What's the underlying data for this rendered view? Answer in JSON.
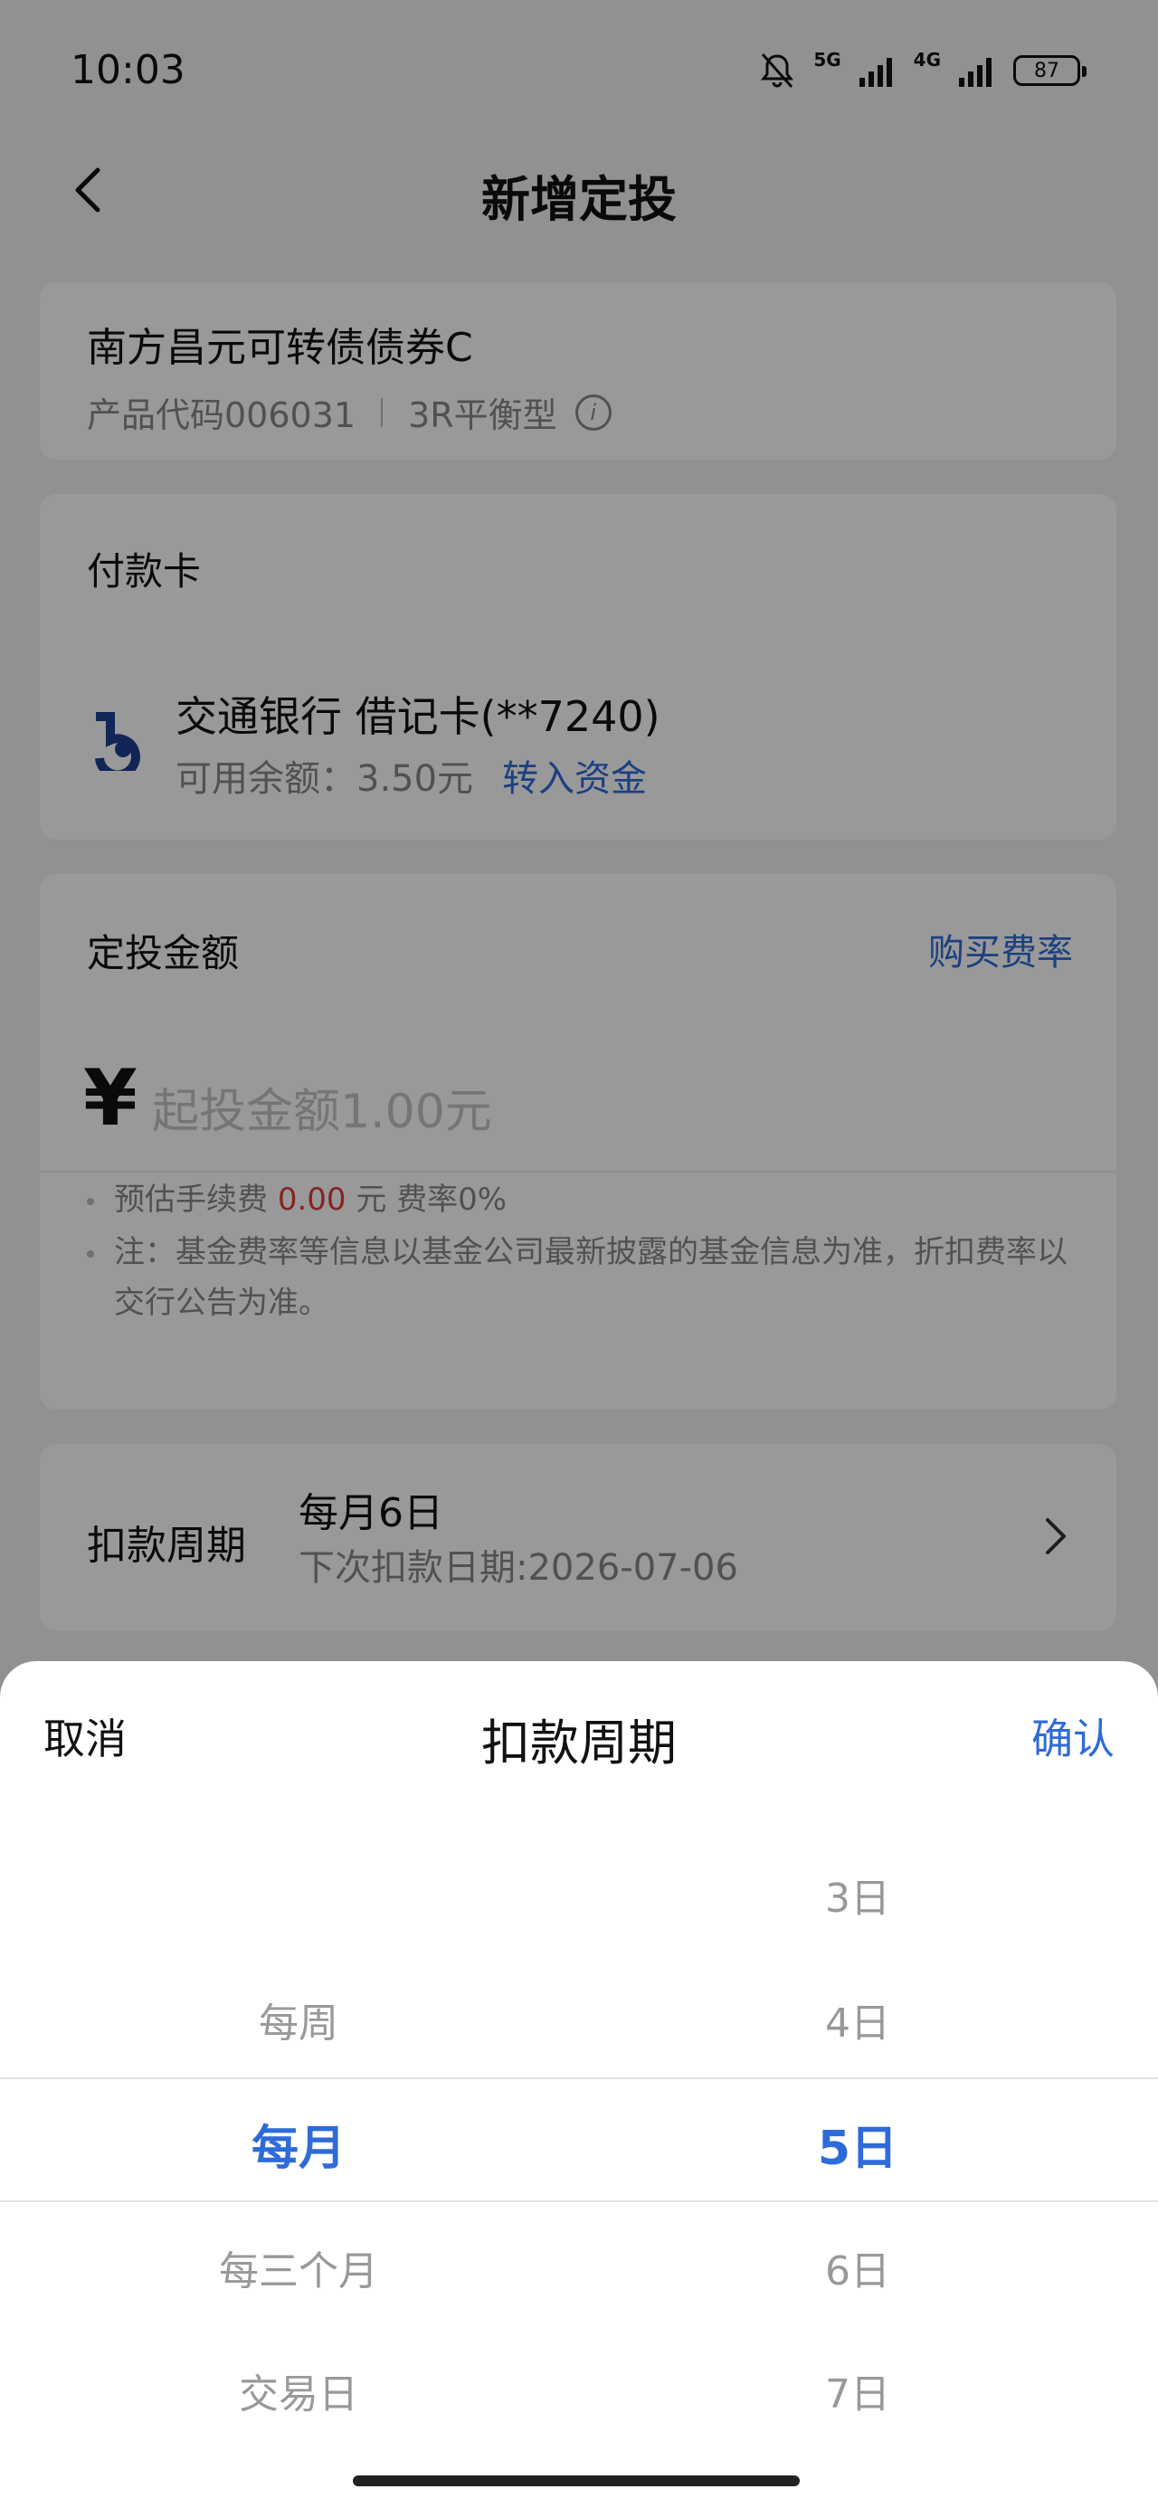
{
  "status_bar": {
    "time": "10:03",
    "network1": "5G",
    "network2": "4G",
    "battery": "87"
  },
  "nav": {
    "title": "新增定投"
  },
  "product": {
    "name": "南方昌元可转债债券C",
    "code": "产品代码006031",
    "risk": "3R平衡型"
  },
  "payment": {
    "title": "付款卡",
    "bank": "交通银行 借记卡(**7240)",
    "balance": "可用余额：3.50元",
    "transfer_link": "转入资金"
  },
  "amount": {
    "title": "定投金额",
    "fee_link": "购买费率",
    "currency": "¥",
    "placeholder": "起投金额1.00元",
    "fee_prefix": "预估手续费",
    "fee_value": "0.00",
    "fee_suffix": "元 费率0%",
    "note": "注：基金费率等信息以基金公司最新披露的基金信息为准，折扣费率以交行公告为准。"
  },
  "cycle": {
    "label": "扣款周期",
    "value": "每月6日",
    "next": "下次扣款日期:2026-07-06"
  },
  "picker": {
    "cancel": "取消",
    "title": "扣款周期",
    "confirm": "确认",
    "period_options": [
      "每周",
      "每月",
      "每三个月",
      "交易日"
    ],
    "day_options": [
      "3日",
      "4日",
      "5日",
      "6日",
      "7日"
    ],
    "selected_period": "每月",
    "selected_day": "5日"
  },
  "colors": {
    "accent": "#2f6bd8",
    "fee_red": "#e03b3b"
  }
}
